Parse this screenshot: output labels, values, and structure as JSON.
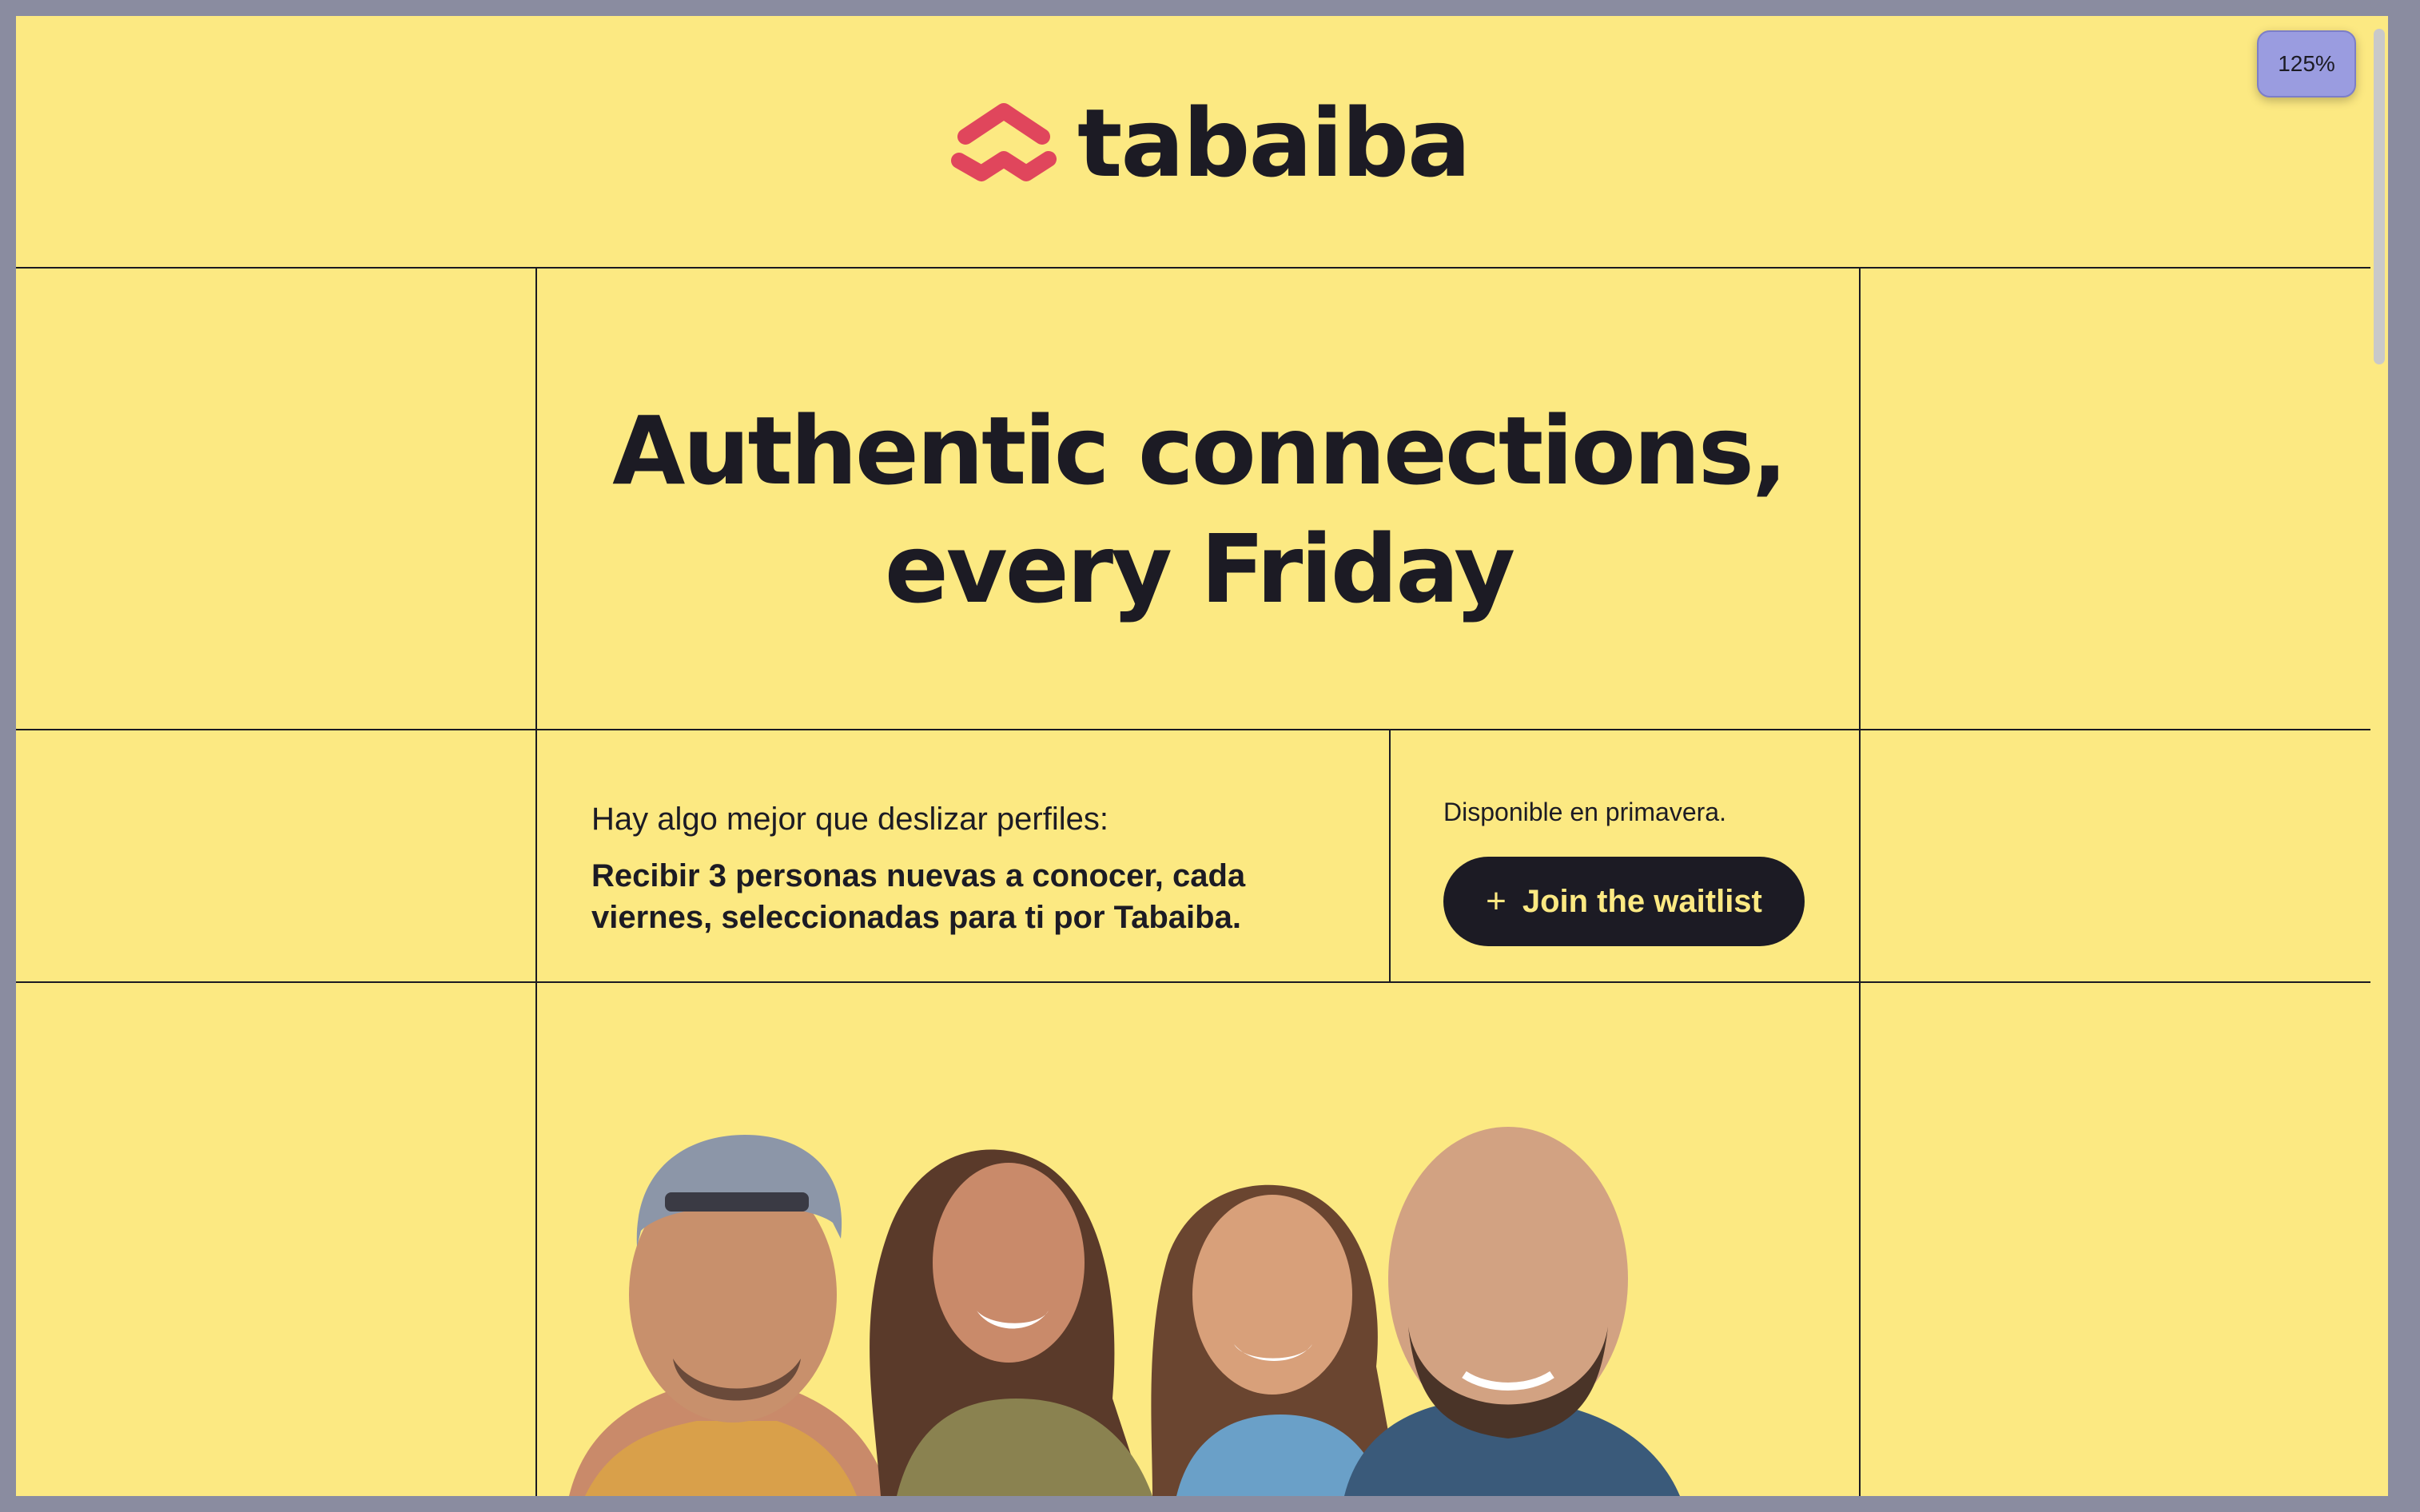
{
  "brand": {
    "name": "tabaiba",
    "logo_color": "#e0465c"
  },
  "hero": {
    "title_line1": "Authentic connections,",
    "title_line2": "every Friday"
  },
  "intro": {
    "lead": "Hay algo mejor que deslizar perfiles:",
    "body": "Recibir 3 personas nuevas a conocer, cada viernes, seleccionadas para ti por Tabaiba."
  },
  "signup": {
    "availability": "Disponible en primavera.",
    "button_icon": "plus-icon",
    "button_label": "Join the waitlist"
  },
  "browser": {
    "zoom_label": "125%"
  },
  "colors": {
    "background": "#fce982",
    "ink": "#1c1b24",
    "accent": "#e0465c"
  }
}
